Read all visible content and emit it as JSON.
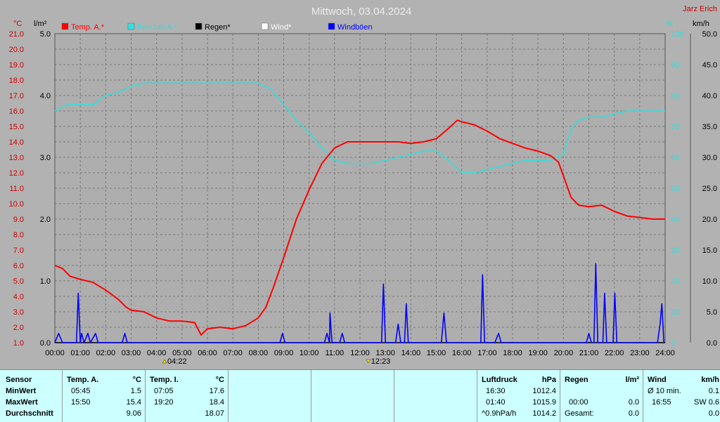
{
  "header": {
    "title": "Mittwoch, 03.04.2024",
    "author": "Jarz Erich",
    "unit_temp": "°C",
    "unit_rain": "l/m²",
    "unit_humidity": "%",
    "unit_wind": "km/h"
  },
  "colors": {
    "background": "#b2b2b2",
    "plot_bg": "#aeaeae",
    "temp": "#ff0000",
    "humidity": "#33dddd",
    "rain": "#000000",
    "wind": "#ffffff",
    "gusts": "#0000ff",
    "left_axis": "#cc0000",
    "stats_bg": "#ccffff"
  },
  "chart_data": {
    "type": "line",
    "title": "Mittwoch, 03.04.2024",
    "legend": [
      {
        "label": "Temp. A.*",
        "color": "#ff0000"
      },
      {
        "label": "Feuchte A.*",
        "color": "#33dddd"
      },
      {
        "label": "Regen*",
        "color": "#000000"
      },
      {
        "label": "Wind*",
        "color": "#ffffff"
      },
      {
        "label": "Windböen",
        "color": "#0000ff"
      }
    ],
    "x_range_hours": [
      0,
      24
    ],
    "x_ticks": [
      "00:00",
      "01:00",
      "02:00",
      "03:00",
      "04:00",
      "05:00",
      "06:00",
      "07:00",
      "08:00",
      "09:00",
      "10:00",
      "11:00",
      "12:00",
      "13:00",
      "14:00",
      "15:00",
      "16:00",
      "17:00",
      "18:00",
      "19:00",
      "20:00",
      "21:00",
      "22:00",
      "23:00",
      "24:00"
    ],
    "temp_axis": {
      "range": [
        1.0,
        21.0
      ],
      "ticks": [
        "1.0",
        "2.0",
        "3.0",
        "4.0",
        "5.0",
        "6.0",
        "7.0",
        "8.0",
        "9.0",
        "10.0",
        "11.0",
        "12.0",
        "13.0",
        "14.0",
        "15.0",
        "16.0",
        "17.0",
        "18.0",
        "19.0",
        "20.0",
        "21.0"
      ]
    },
    "rain_axis": {
      "range": [
        0,
        5
      ],
      "ticks": [
        "0.0",
        "1.0",
        "2.0",
        "3.0",
        "4.0",
        "5.0"
      ]
    },
    "humidity_axis": {
      "range": [
        0,
        100
      ],
      "ticks": [
        "0",
        "10",
        "20",
        "30",
        "40",
        "50",
        "60",
        "70",
        "80",
        "90",
        "100"
      ]
    },
    "wind_axis": {
      "range": [
        0,
        50
      ],
      "ticks": [
        "0.0",
        "5.0",
        "10.0",
        "15.0",
        "20.0",
        "25.0",
        "30.0",
        "35.0",
        "40.0",
        "45.0",
        "50.0"
      ]
    },
    "sunrise_label": "04:22",
    "sunset_label": "12:23",
    "sunrise_hour": 4.37,
    "sunset_hour": 12.38,
    "series": [
      {
        "name": "Temp. A.*",
        "axis": "temp",
        "points": [
          [
            0,
            6.0
          ],
          [
            0.3,
            5.8
          ],
          [
            0.6,
            5.3
          ],
          [
            1.0,
            5.1
          ],
          [
            1.5,
            4.9
          ],
          [
            2.0,
            4.4
          ],
          [
            2.5,
            3.8
          ],
          [
            2.8,
            3.3
          ],
          [
            3.0,
            3.1
          ],
          [
            3.5,
            3.0
          ],
          [
            4.0,
            2.6
          ],
          [
            4.5,
            2.4
          ],
          [
            5.0,
            2.4
          ],
          [
            5.5,
            2.3
          ],
          [
            5.75,
            1.5
          ],
          [
            6.0,
            1.9
          ],
          [
            6.5,
            2.0
          ],
          [
            7.0,
            1.9
          ],
          [
            7.5,
            2.1
          ],
          [
            8.0,
            2.6
          ],
          [
            8.3,
            3.3
          ],
          [
            8.6,
            4.6
          ],
          [
            9.0,
            6.5
          ],
          [
            9.5,
            9.0
          ],
          [
            10.0,
            10.9
          ],
          [
            10.5,
            12.6
          ],
          [
            11.0,
            13.6
          ],
          [
            11.5,
            14.0
          ],
          [
            12.0,
            14.0
          ],
          [
            12.5,
            14.0
          ],
          [
            13.0,
            14.0
          ],
          [
            13.5,
            14.0
          ],
          [
            14.0,
            13.9
          ],
          [
            14.5,
            14.0
          ],
          [
            15.0,
            14.2
          ],
          [
            15.5,
            14.9
          ],
          [
            15.83,
            15.4
          ],
          [
            16.0,
            15.3
          ],
          [
            16.5,
            15.1
          ],
          [
            17.0,
            14.7
          ],
          [
            17.5,
            14.2
          ],
          [
            18.0,
            13.9
          ],
          [
            18.5,
            13.6
          ],
          [
            19.0,
            13.4
          ],
          [
            19.5,
            13.1
          ],
          [
            19.8,
            12.7
          ],
          [
            20.0,
            11.8
          ],
          [
            20.3,
            10.4
          ],
          [
            20.6,
            9.9
          ],
          [
            21.0,
            9.8
          ],
          [
            21.5,
            9.9
          ],
          [
            22.0,
            9.5
          ],
          [
            22.5,
            9.2
          ],
          [
            23.0,
            9.1
          ],
          [
            23.5,
            9.0
          ],
          [
            24.0,
            9.0
          ]
        ]
      },
      {
        "name": "Feuchte A.*",
        "axis": "humidity",
        "points": [
          [
            0,
            75
          ],
          [
            0.5,
            77
          ],
          [
            1.0,
            77
          ],
          [
            1.5,
            77
          ],
          [
            2.0,
            80
          ],
          [
            2.5,
            81
          ],
          [
            3.0,
            83
          ],
          [
            3.5,
            84
          ],
          [
            4.0,
            84
          ],
          [
            5.0,
            84
          ],
          [
            6.0,
            84
          ],
          [
            7.0,
            84
          ],
          [
            8.0,
            84
          ],
          [
            8.5,
            82
          ],
          [
            9.0,
            77
          ],
          [
            9.5,
            72
          ],
          [
            10.0,
            68
          ],
          [
            10.5,
            63
          ],
          [
            11.0,
            59
          ],
          [
            11.5,
            58
          ],
          [
            12.0,
            58
          ],
          [
            12.5,
            58
          ],
          [
            13.0,
            59
          ],
          [
            13.5,
            60
          ],
          [
            14.0,
            61
          ],
          [
            14.5,
            62
          ],
          [
            15.0,
            62
          ],
          [
            15.5,
            59
          ],
          [
            16.0,
            55
          ],
          [
            16.5,
            55
          ],
          [
            17.0,
            56
          ],
          [
            17.5,
            57
          ],
          [
            18.0,
            58
          ],
          [
            18.5,
            59
          ],
          [
            19.0,
            59
          ],
          [
            19.5,
            59
          ],
          [
            20.0,
            61
          ],
          [
            20.3,
            69
          ],
          [
            20.6,
            72
          ],
          [
            21.0,
            73
          ],
          [
            21.5,
            73
          ],
          [
            22.0,
            74
          ],
          [
            22.5,
            75
          ],
          [
            23.0,
            75
          ],
          [
            23.5,
            75
          ],
          [
            24.0,
            75
          ]
        ]
      },
      {
        "name": "Regen*",
        "axis": "rain",
        "points": [
          [
            0,
            0
          ],
          [
            24,
            0
          ]
        ]
      },
      {
        "name": "Windböen",
        "axis": "wind",
        "points": [
          [
            0,
            0
          ],
          [
            0.15,
            1.5
          ],
          [
            0.3,
            0
          ],
          [
            0.85,
            0
          ],
          [
            0.92,
            8.0
          ],
          [
            1.0,
            0
          ],
          [
            1.05,
            1.5
          ],
          [
            1.15,
            0
          ],
          [
            1.3,
            1.5
          ],
          [
            1.4,
            0
          ],
          [
            1.6,
            1.5
          ],
          [
            1.7,
            0
          ],
          [
            2.65,
            0
          ],
          [
            2.75,
            1.5
          ],
          [
            2.85,
            0
          ],
          [
            8.85,
            0
          ],
          [
            8.95,
            1.5
          ],
          [
            9.05,
            0
          ],
          [
            10.6,
            0
          ],
          [
            10.7,
            1.5
          ],
          [
            10.8,
            0
          ],
          [
            10.82,
            4.8
          ],
          [
            10.9,
            0
          ],
          [
            11.2,
            0
          ],
          [
            11.3,
            1.5
          ],
          [
            11.4,
            0
          ],
          [
            12.85,
            0
          ],
          [
            12.92,
            9.5
          ],
          [
            13.0,
            0
          ],
          [
            13.4,
            0
          ],
          [
            13.5,
            3.0
          ],
          [
            13.6,
            0
          ],
          [
            13.75,
            0
          ],
          [
            13.82,
            6.3
          ],
          [
            13.9,
            0
          ],
          [
            15.2,
            0
          ],
          [
            15.3,
            4.8
          ],
          [
            15.4,
            0
          ],
          [
            16.75,
            0
          ],
          [
            16.82,
            11.0
          ],
          [
            16.9,
            0
          ],
          [
            17.3,
            0
          ],
          [
            17.45,
            1.5
          ],
          [
            17.55,
            0
          ],
          [
            20.9,
            0
          ],
          [
            21.0,
            1.5
          ],
          [
            21.1,
            0
          ],
          [
            21.2,
            0
          ],
          [
            21.27,
            12.8
          ],
          [
            21.35,
            0
          ],
          [
            21.55,
            0
          ],
          [
            21.62,
            8.0
          ],
          [
            21.7,
            0
          ],
          [
            21.95,
            0
          ],
          [
            22.02,
            8.0
          ],
          [
            22.1,
            0
          ],
          [
            23.7,
            0
          ],
          [
            23.8,
            3.0
          ],
          [
            23.87,
            6.3
          ],
          [
            23.95,
            0
          ]
        ]
      }
    ]
  },
  "stats": {
    "sensor": {
      "header": "Sensor",
      "rows": [
        "MinWert",
        "MaxWert",
        "Durchschnitt"
      ]
    },
    "temp_a": {
      "header": "Temp. A.",
      "unit": "°C",
      "min_time": "05:45",
      "min_val": "1.5",
      "max_time": "15:50",
      "max_val": "15.4",
      "avg": "9.06"
    },
    "temp_i": {
      "header": "Temp. I.",
      "unit": "°C",
      "min_time": "07:05",
      "min_val": "17.6",
      "max_time": "19:20",
      "max_val": "18.4",
      "avg": "18.07"
    },
    "pressure": {
      "header": "Luftdruck",
      "unit": "hPa",
      "r1_time": "16:30",
      "r1_val": "1012.4",
      "r2_time": "01:40",
      "r2_val": "1015.9",
      "r3_label": "^0.9hPa/h",
      "r3_val": "1014.2"
    },
    "rain": {
      "header": "Regen",
      "unit": "l/m²",
      "r2_time": "00:00",
      "r2_val": "0.0",
      "r3_label": "Gesamt:",
      "r3_val": "0.0"
    },
    "wind": {
      "header": "Wind",
      "unit": "km/h",
      "r1_label": "Ø 10 min.",
      "r1_val": "0.1",
      "r2_time": "16:55",
      "r2_val": "SW 0.6",
      "r3_val": "0.0"
    }
  }
}
